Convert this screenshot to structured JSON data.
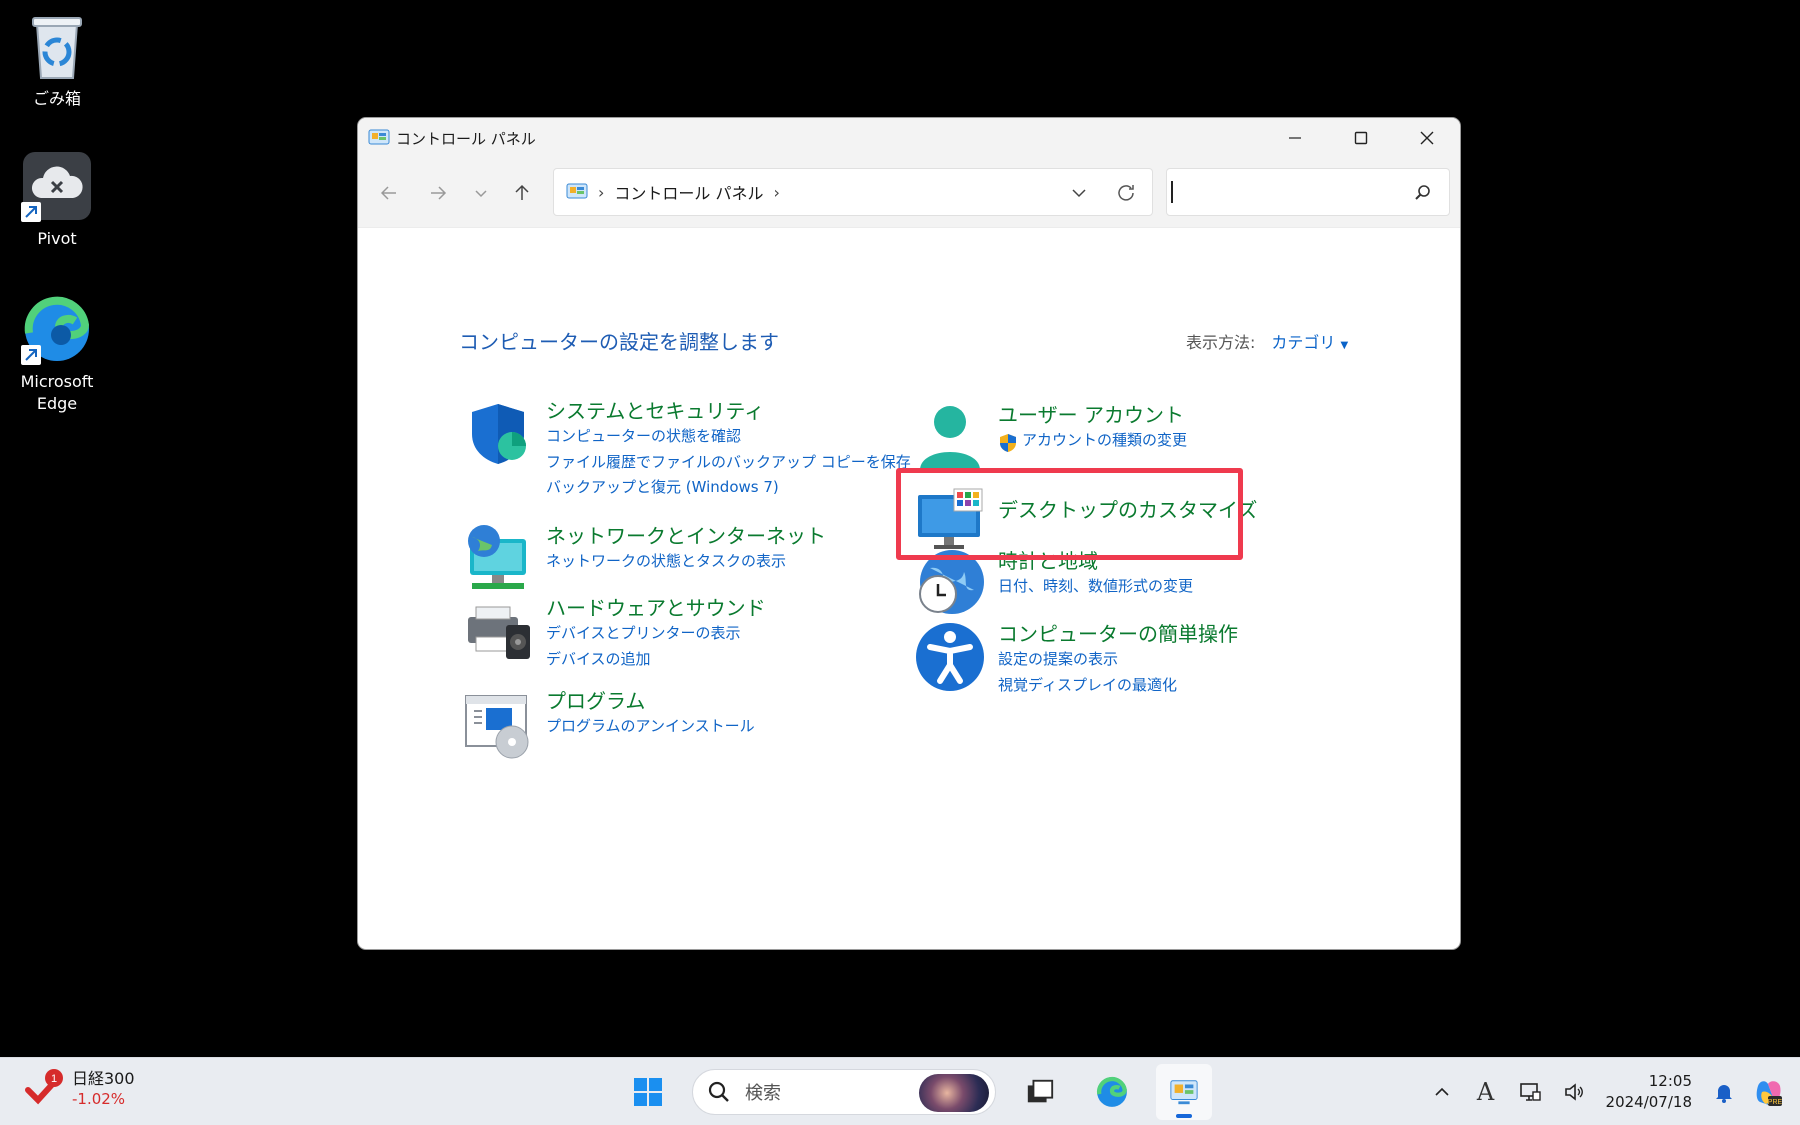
{
  "desktop": {
    "icons": [
      {
        "label": "ごみ箱"
      },
      {
        "label": "Pivot"
      },
      {
        "label": "Microsoft Edge"
      }
    ]
  },
  "window": {
    "title": "コントロール パネル",
    "breadcrumb": [
      "コントロール パネル"
    ],
    "search_placeholder": ""
  },
  "content": {
    "heading": "コンピューターの設定を調整します",
    "view_by_label": "表示方法:",
    "view_by_value": "カテゴリ",
    "categories": [
      {
        "title": "システムとセキュリティ",
        "icon": "shield-icon",
        "links": [
          "コンピューターの状態を確認",
          "ファイル履歴でファイルのバックアップ コピーを保存",
          "バックアップと復元 (Windows 7)"
        ]
      },
      {
        "title": "ネットワークとインターネット",
        "icon": "network-globe-icon",
        "links": [
          "ネットワークの状態とタスクの表示"
        ]
      },
      {
        "title": "ハードウェアとサウンド",
        "icon": "printer-speaker-icon",
        "links": [
          "デバイスとプリンターの表示",
          "デバイスの追加"
        ]
      },
      {
        "title": "プログラム",
        "icon": "programs-icon",
        "links": [
          "プログラムのアンインストール"
        ]
      },
      {
        "title": "ユーザー アカウント",
        "icon": "user-icon",
        "links": [
          "アカウントの種類の変更"
        ]
      },
      {
        "title": "デスクトップのカスタマイズ",
        "icon": "monitor-icon",
        "links": []
      },
      {
        "title": "時計と地域",
        "icon": "clock-globe-icon",
        "links": [
          "日付、時刻、数値形式の変更"
        ]
      },
      {
        "title": "コンピューターの簡単操作",
        "icon": "accessibility-icon",
        "links": [
          "設定の提案の表示",
          "視覚ディスプレイの最適化"
        ]
      }
    ],
    "highlight_color": "#ef3a4e"
  },
  "taskbar": {
    "widget_name": "日経300",
    "widget_change": "-1.02%",
    "widget_badge": "1",
    "search_label": "検索",
    "time": "12:05",
    "date": "2024/07/18",
    "ime": "A",
    "accent": "#1667d9"
  }
}
